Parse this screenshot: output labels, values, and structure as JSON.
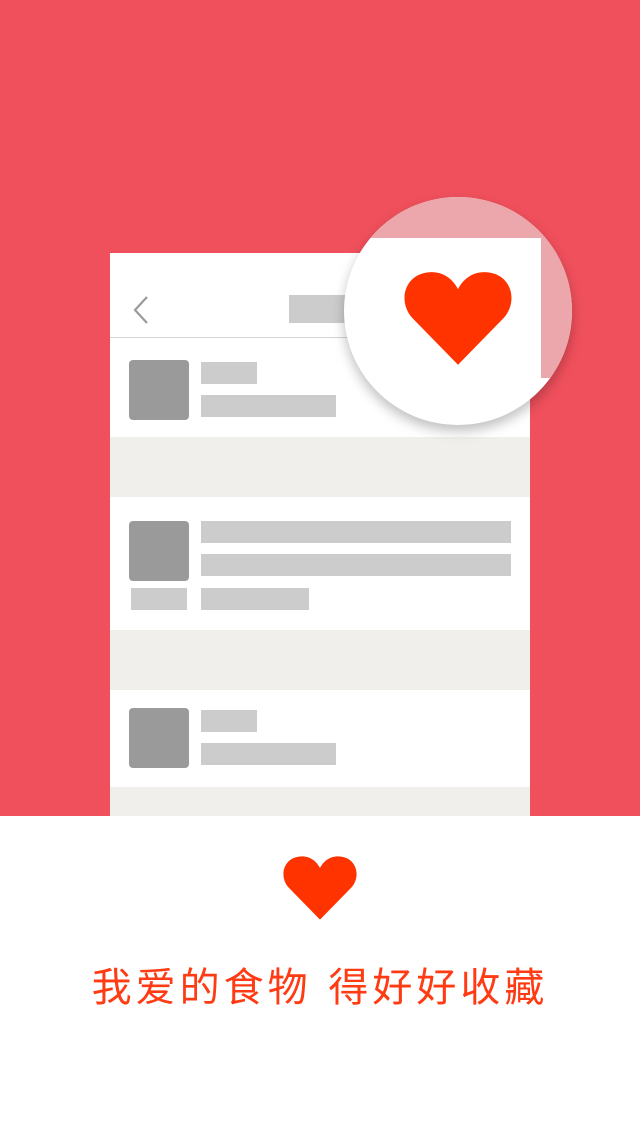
{
  "colors": {
    "hero_background": "#f0505c",
    "accent_heart": "#ff3300",
    "tagline_text": "#ff3b14",
    "placeholder_gray": "#cccccc",
    "thumbnail_gray": "#9a9a9a",
    "separator_beige": "#f0efeb"
  },
  "mockup": {
    "navbar": {
      "back_icon": "chevron-left-icon",
      "title": ""
    },
    "list": [
      {
        "thumbnail": "image-placeholder",
        "lines": 2
      },
      {
        "thumbnail": "image-placeholder",
        "lines": 3
      },
      {
        "thumbnail": "image-placeholder",
        "lines": 2
      }
    ]
  },
  "magnifier": {
    "icon": "heart-icon"
  },
  "bottom": {
    "icon": "heart-icon",
    "tagline": "我爱的食物 得好好收藏"
  }
}
